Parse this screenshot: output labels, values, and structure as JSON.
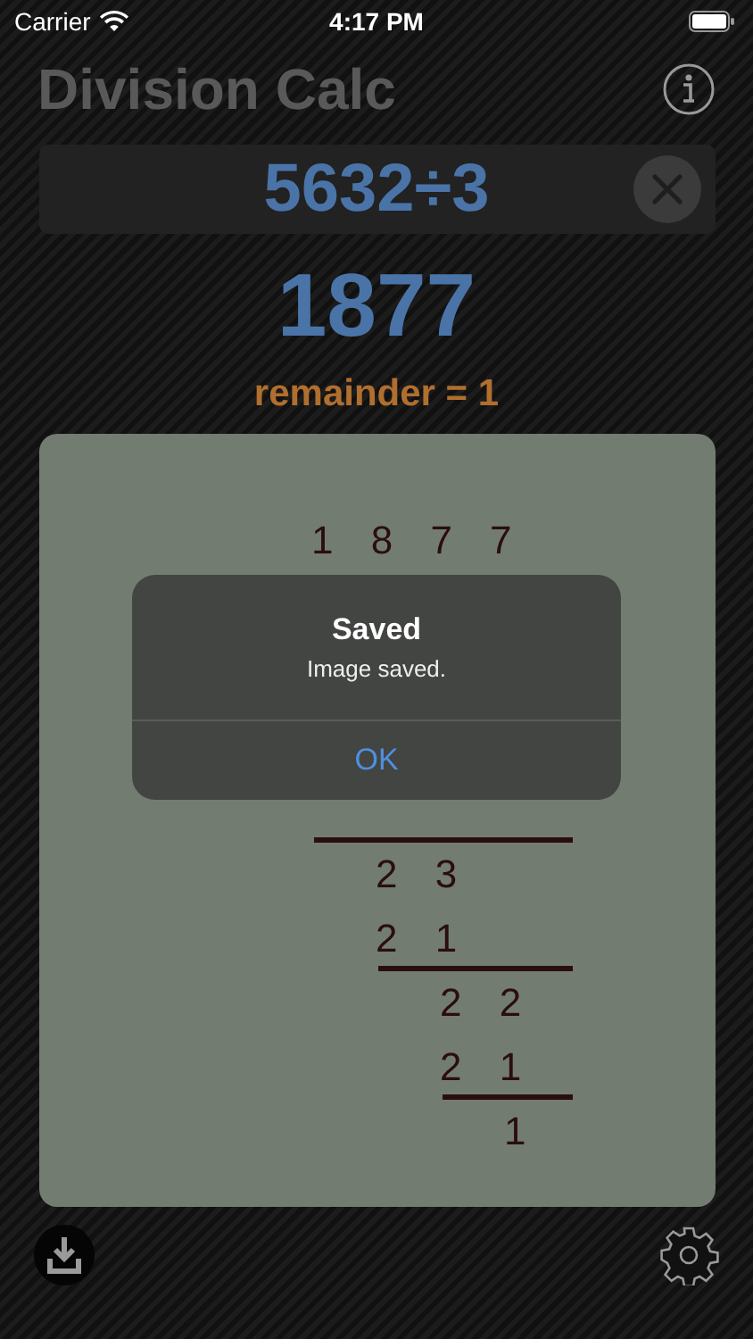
{
  "status_bar": {
    "carrier": "Carrier",
    "time": "4:17 PM"
  },
  "title": "Division Calc",
  "expression": "5632÷3",
  "result": "1877",
  "remainder": "remainder = 1",
  "work": {
    "quotient": "1 8 7 7",
    "rows": [
      "2 3",
      "2 1",
      "2 2",
      "2 1",
      "1"
    ]
  },
  "alert": {
    "title": "Saved",
    "message": "Image saved.",
    "button": "OK"
  }
}
